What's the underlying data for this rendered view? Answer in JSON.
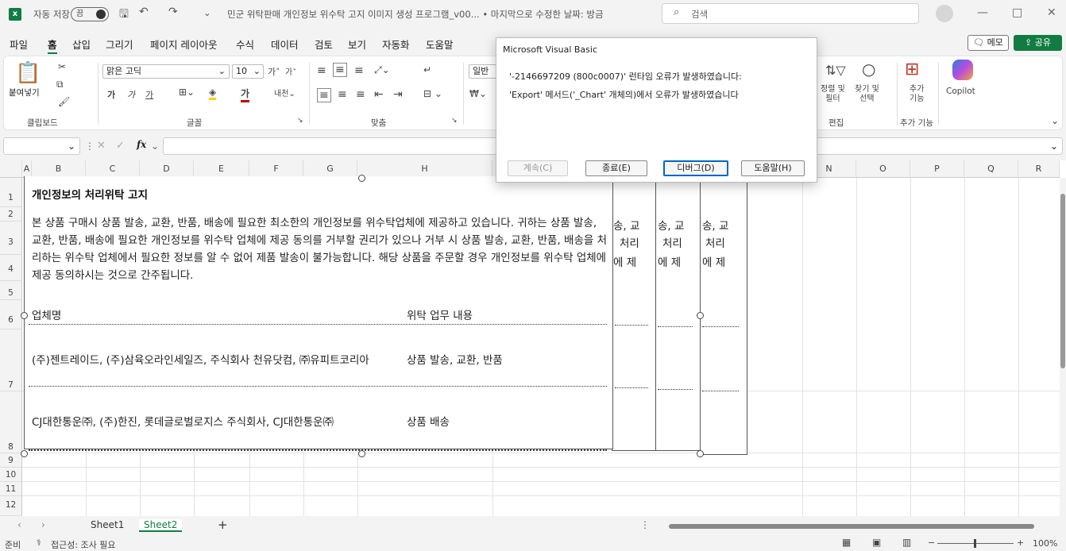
{
  "titlebar": {
    "autosave_label": "자동 저장",
    "autosave_state": "끔",
    "doc_title": "민군 위탁판매 개인정보 위수탁 고지 이미지 생성 프로그램_v00... • 마지막으로 수정한 날짜: 방금",
    "search_placeholder": "검색",
    "minimize": "—",
    "maximize": "□",
    "close": "✕"
  },
  "menu": {
    "items": [
      "파일",
      "홈",
      "삽입",
      "그리기",
      "페이지 레이아웃",
      "수식",
      "데이터",
      "검토",
      "보기",
      "자동화",
      "도움말"
    ],
    "memo_label": "메모",
    "share_label": "공유"
  },
  "ribbon": {
    "paste_label": "붙여넣기",
    "clipboard_label": "클립보드",
    "font_name": "맑은 고딕",
    "font_size": "10",
    "font_label": "글꼴",
    "align_label": "맞춤",
    "number_format": "일반",
    "sort_filter_label": "정렬 및\n필터",
    "find_select_label": "찾기 및\n선택",
    "editing_label": "편집",
    "addins_label": "추가\n기능",
    "addins_group_label": "추가 기능",
    "copilot_label": "Copilot",
    "bold": "가",
    "italic": "가",
    "underline": "가",
    "grow_font": "가˄",
    "shrink_font": "가˅"
  },
  "formula_bar": {
    "name_box": "",
    "fx": "fx",
    "formula": ""
  },
  "grid": {
    "columns": [
      "A",
      "B",
      "C",
      "D",
      "E",
      "F",
      "G",
      "H",
      "N",
      "O",
      "P",
      "Q",
      "R"
    ],
    "rows": [
      "1",
      "2",
      "3",
      "4",
      "5",
      "6",
      "7",
      "8",
      "9",
      "10",
      "11",
      "12"
    ]
  },
  "notice": {
    "title": "개인정보의 처리위탁 고지",
    "body": "본 상품 구매시 상품 발송, 교환, 반품, 배송에 필요한 최소한의 개인정보를 위수탁업체에 제공하고 있습니다. 귀하는 상품 발송, 교환, 반품, 배송에 필요한 개인정보를 위수탁 업체에 제공 동의를 거부할 권리가 있으나 거부 시 상품 발송, 교환, 반품, 배송을 처리하는 위수탁 업체에서 필요한 정보를 알 수 없어 제품 발송이 불가능합니다. 해당 상품을 주문할 경우 개인정보를 위수탁 업체에 제공 동의하시는 것으로 간주됩니다.",
    "col_company": "업체명",
    "col_task": "위탁 업무 내용",
    "row1_company": "(주)젠트레이드, (주)삼육오라인세일즈, 주식회사 천유닷컴, ㈜유피트코리아",
    "row1_task": "상품 발송, 교환, 반품",
    "row2_company": "CJ대한통운㈜, (주)한진, 롯데글로벌로지스 주식회사, CJ대한통운㈜",
    "row2_task": "상품 배송",
    "frag_a": "송, 교",
    "frag_b": "처리",
    "frag_c": "에 제"
  },
  "dialog": {
    "title": "Microsoft Visual Basic",
    "line1": "'-2146697209 (800c0007)' 런타임 오류가 발생하였습니다:",
    "line2": "'Export' 메서드('_Chart' 개체의)에서 오류가 발생하였습니다",
    "btn_continue": "계속(C)",
    "btn_end": "종료(E)",
    "btn_debug": "디버그(D)",
    "btn_help": "도움말(H)"
  },
  "tabs": {
    "sheet1": "Sheet1",
    "sheet2": "Sheet2",
    "add": "+"
  },
  "status": {
    "ready": "준비",
    "accessibility": "접근성: 조사 필요",
    "zoom": "100%"
  }
}
